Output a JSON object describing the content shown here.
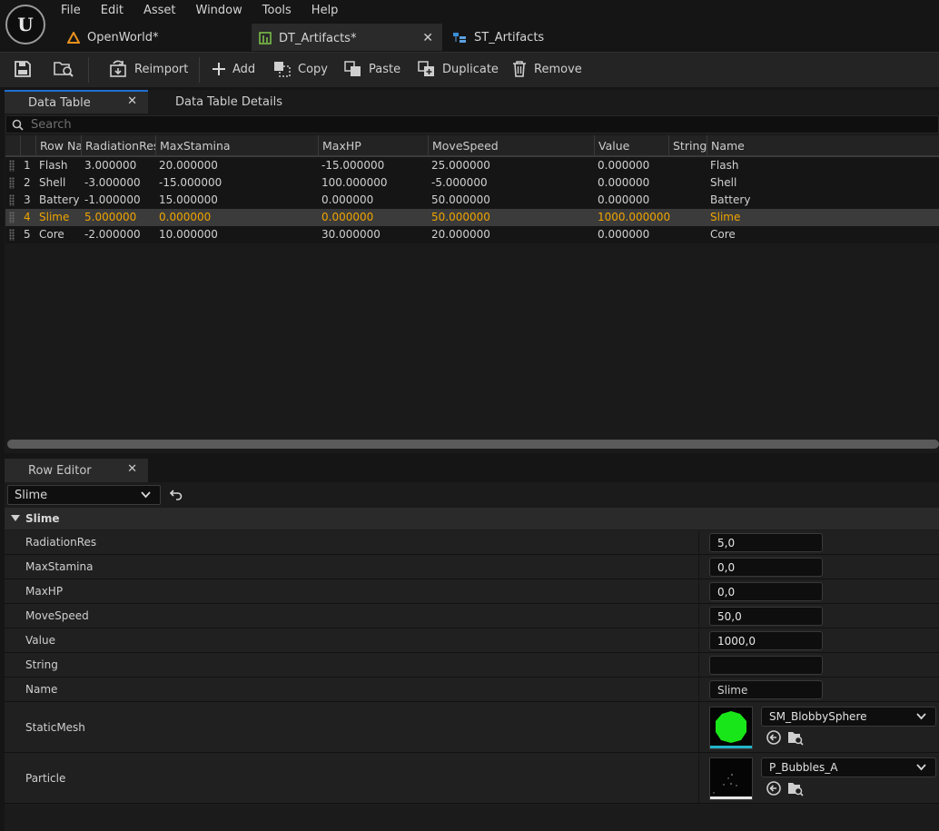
{
  "menu": [
    "File",
    "Edit",
    "Asset",
    "Window",
    "Tools",
    "Help"
  ],
  "doc_tabs": [
    {
      "label": "OpenWorld*",
      "icon": "level-icon"
    },
    {
      "label": "DT_Artifacts*",
      "icon": "datatable-icon",
      "active": true
    },
    {
      "label": "ST_Artifacts",
      "icon": "structure-icon"
    }
  ],
  "toolbar": {
    "reimport": "Reimport",
    "add": "Add",
    "copy": "Copy",
    "paste": "Paste",
    "duplicate": "Duplicate",
    "remove": "Remove"
  },
  "panel_tabs": {
    "data_table": "Data Table",
    "details": "Data Table Details"
  },
  "search": {
    "placeholder": "Search"
  },
  "table": {
    "columns": [
      "Row Na",
      "RadiationRes",
      "MaxStamina",
      "MaxHP",
      "MoveSpeed",
      "Value",
      "String",
      "Name"
    ],
    "rows": [
      [
        "1",
        "Flash",
        "3.000000",
        "20.000000",
        "-15.000000",
        "25.000000",
        "0.000000",
        "",
        "Flash"
      ],
      [
        "2",
        "Shell",
        "-3.000000",
        "-15.000000",
        "100.000000",
        "-5.000000",
        "0.000000",
        "",
        "Shell"
      ],
      [
        "3",
        "Battery",
        "-1.000000",
        "15.000000",
        "0.000000",
        "50.000000",
        "0.000000",
        "",
        "Battery"
      ],
      [
        "4",
        "Slime",
        "5.000000",
        "0.000000",
        "0.000000",
        "50.000000",
        "1000.000000",
        "",
        "Slime"
      ],
      [
        "5",
        "Core",
        "-2.000000",
        "10.000000",
        "30.000000",
        "20.000000",
        "0.000000",
        "",
        "Core"
      ]
    ],
    "selected_row": 4
  },
  "row_editor": {
    "tab_label": "Row Editor",
    "selected_row": "Slime",
    "category": "Slime",
    "props": {
      "radiation_res": {
        "label": "RadiationRes",
        "value": "5,0"
      },
      "max_stamina": {
        "label": "MaxStamina",
        "value": "0,0"
      },
      "max_hp": {
        "label": "MaxHP",
        "value": "0,0"
      },
      "move_speed": {
        "label": "MoveSpeed",
        "value": "50,0"
      },
      "value": {
        "label": "Value",
        "value": "1000,0"
      },
      "string": {
        "label": "String",
        "value": ""
      },
      "name": {
        "label": "Name",
        "value": "Slime"
      },
      "static_mesh": {
        "label": "StaticMesh",
        "value": "SM_BlobbySphere"
      },
      "particle": {
        "label": "Particle",
        "value": "P_Bubbles_A"
      }
    }
  },
  "colors": {
    "selected_text": "#f0a500",
    "accent_blue": "#1f6fd0",
    "mesh_green": "#19e619",
    "mesh_bar": "#21b5c9",
    "particle_bar": "#e6e6e6"
  }
}
